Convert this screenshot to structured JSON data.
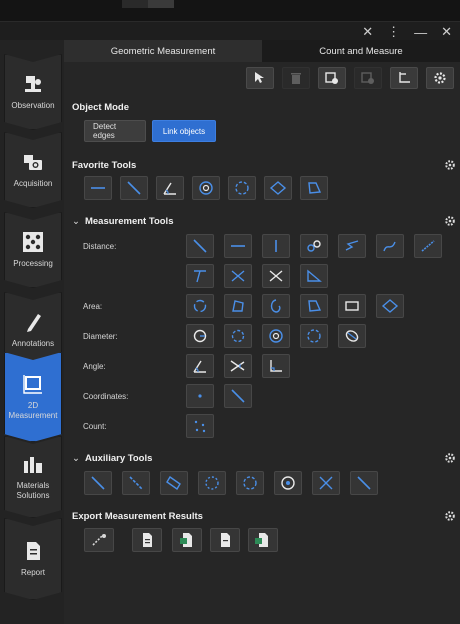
{
  "left_nav": {
    "items": [
      {
        "label": "Observation",
        "icon": "microscope-icon",
        "active": false
      },
      {
        "label": "Acquisition",
        "icon": "camera-icon",
        "active": false
      },
      {
        "label": "Processing",
        "icon": "dice-grid-icon",
        "active": false
      },
      {
        "label": "Annotations",
        "icon": "pencil-abc-icon",
        "active": false
      },
      {
        "label": "2D Measurement",
        "icon": "measure-frame-icon",
        "active": true
      },
      {
        "label": "Materials Solutions",
        "icon": "bar-chart-grid-icon",
        "active": false
      },
      {
        "label": "Report",
        "icon": "document-icon",
        "active": false
      }
    ]
  },
  "tabs": [
    {
      "label": "Geometric Measurement",
      "active": true
    },
    {
      "label": "Count and Measure",
      "active": false
    }
  ],
  "toolbar": [
    {
      "icon": "select-arrow-icon",
      "disabled": false
    },
    {
      "icon": "delete-icon",
      "disabled": true
    },
    {
      "icon": "copy-settings-icon",
      "disabled": false
    },
    {
      "icon": "paste-settings-icon",
      "disabled": true
    },
    {
      "icon": "axis-icon",
      "disabled": false
    },
    {
      "icon": "settings-gear-icon",
      "disabled": false
    }
  ],
  "object_mode": {
    "title": "Object Mode",
    "detect_label": "Detect edges",
    "link_label": "Link objects",
    "active": "link"
  },
  "favorite_tools": {
    "title": "Favorite Tools"
  },
  "measurement_tools": {
    "title": "Measurement Tools",
    "labels": {
      "distance": "Distance:",
      "area": "Area:",
      "diameter": "Diameter:",
      "angle": "Angle:",
      "coordinates": "Coordinates:",
      "count": "Count:"
    }
  },
  "auxiliary_tools": {
    "title": "Auxiliary Tools"
  },
  "export": {
    "title": "Export Measurement Results"
  },
  "colors": {
    "accent": "#2f6fd1",
    "icon_blue": "#4a8fe8",
    "panel": "#262626"
  }
}
